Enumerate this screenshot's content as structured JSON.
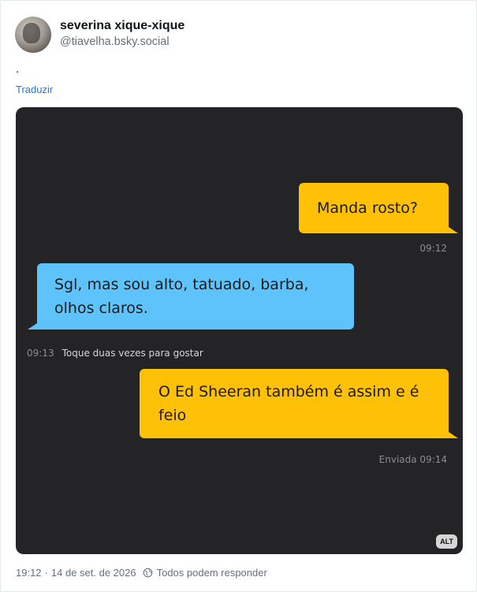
{
  "post": {
    "author": {
      "display_name": "severina xique-xique",
      "handle": "@tiavelha.bsky.social",
      "avatar_icon": "avatar-photo"
    },
    "text": ".",
    "translate_label": "Traduzir",
    "media": {
      "alt_badge": "ALT",
      "messages": [
        {
          "text": "Manda rosto?",
          "color": "#ffc105"
        },
        {
          "text": "Sgl, mas sou alto, tatuado, barba, olhos claros.",
          "color": "#5ec3fb"
        },
        {
          "text": "O Ed Sheeran também é assim e é feio",
          "color": "#ffc105"
        }
      ],
      "timestamps": {
        "first": "09:12",
        "second_time": "09:13",
        "second_hint": "Toque duas vezes para gostar",
        "third": "Enviada 09:14"
      }
    },
    "footer": {
      "time": "19:12",
      "date": "14 de set. de 2026",
      "separator": "·",
      "reply_setting": "Todos podem responder",
      "reply_icon": "earth-icon"
    }
  },
  "colors": {
    "accent": "#1d7de8",
    "muted": "#66707a",
    "media_bg": "#242426"
  }
}
